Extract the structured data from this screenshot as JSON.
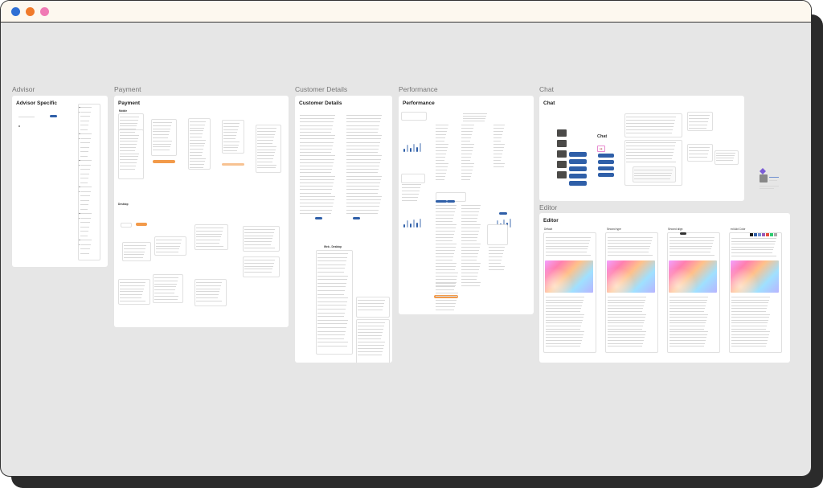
{
  "window": {
    "controls": [
      "close",
      "minimize",
      "zoom"
    ]
  },
  "frames": {
    "advisor": {
      "label": "Advisor",
      "title": "Advisor Specific"
    },
    "payment": {
      "label": "Payment",
      "title": "Payment",
      "mobile": "Mobile",
      "desktop": "Desktop"
    },
    "customer": {
      "label": "Customer Details",
      "title": "Customer Details",
      "web_desktop": "Web - Desktop"
    },
    "performance": {
      "label": "Performance",
      "title": "Performance"
    },
    "chat": {
      "label": "Chat",
      "title": "Chat",
      "center_title": "Chat"
    },
    "editor": {
      "label": "Editor",
      "title": "Editor",
      "variants": [
        "Default",
        "Second type",
        "Second align",
        "ed Add Color"
      ]
    }
  },
  "colors": {
    "primary": "#2f5fa8",
    "accent": "#f29a4a",
    "canvas": "#e6e6e6"
  }
}
